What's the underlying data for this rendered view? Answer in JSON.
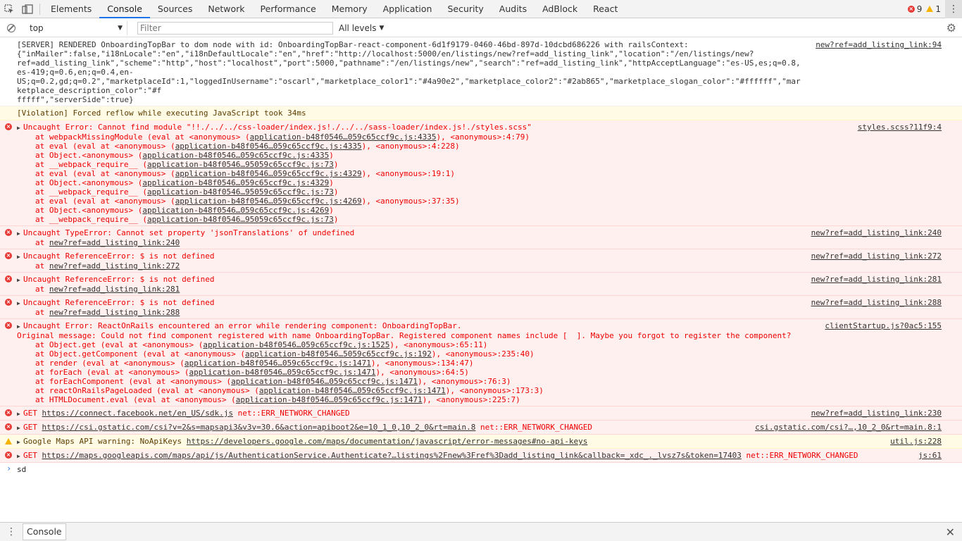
{
  "tabs": [
    {
      "label": "Elements"
    },
    {
      "label": "Console",
      "active": true
    },
    {
      "label": "Sources"
    },
    {
      "label": "Network"
    },
    {
      "label": "Performance"
    },
    {
      "label": "Memory"
    },
    {
      "label": "Application"
    },
    {
      "label": "Security"
    },
    {
      "label": "Audits"
    },
    {
      "label": "AdBlock"
    },
    {
      "label": "React"
    }
  ],
  "counts": {
    "errors": "9",
    "warnings": "1"
  },
  "toolbar": {
    "context": "top",
    "filter_placeholder": "Filter",
    "levels": "All levels"
  },
  "colors": {
    "error_bg": "#fff0f0",
    "error_text": "#ee0000",
    "warn_bg": "#fffbe5",
    "accent": "#1a73e8"
  },
  "messages": {
    "m1": {
      "text": "[SERVER] RENDERED OnboardingTopBar to dom node with id: OnboardingTopBar-react-component-6d1f9179-0460-46bd-897d-10dcbd686226 with railsContext:\n{\"inMailer\":false,\"i18nLocale\":\"en\",\"i18nDefaultLocale\":\"en\",\"href\":\"http://localhost:5000/en/listings/new?ref=add_listing_link\",\"location\":\"/en/listings/new?\nref=add_listing_link\",\"scheme\":\"http\",\"host\":\"localhost\",\"port\":5000,\"pathname\":\"/en/listings/new\",\"search\":\"ref=add_listing_link\",\"httpAcceptLanguage\":\"es-US,es;q=0.8,es-419;q=0.6,en;q=0.4,en-\nUS;q=0.2,gd;q=0.2\",\"marketplaceId\":1,\"loggedInUsername\":\"oscarl\",\"marketplace_color1\":\"#4a90e2\",\"marketplace_color2\":\"#2ab865\",\"marketplace_slogan_color\":\"#ffffff\",\"marketplace_description_color\":\"#f\nfffff\",\"serverSide\":true}",
      "src": "new?ref=add_listing_link:94"
    },
    "m2": {
      "text": "[Violation] Forced reflow while executing JavaScript took 34ms"
    },
    "m3": {
      "text": "Uncaught Error: Cannot find module \"!!./../../css-loader/index.js!./../../sass-loader/index.js!./styles.scss\"",
      "src": "styles.scss?11f9:4",
      "stack": [
        {
          "pre": "at webpackMissingModule (eval at <anonymous> (",
          "link": "application-b48f0546…059c65ccf9c.js:4335",
          "post": "), <anonymous>:4:79)"
        },
        {
          "pre": "at eval (eval at <anonymous> (",
          "link": "application-b48f0546…059c65ccf9c.js:4335",
          "post": "), <anonymous>:4:228)"
        },
        {
          "pre": "at Object.<anonymous> (",
          "link": "application-b48f0546…059c65ccf9c.js:4335",
          "post": ")"
        },
        {
          "pre": "at __webpack_require__ (",
          "link": "application-b48f0546…95059c65ccf9c.js:73",
          "post": ")"
        },
        {
          "pre": "at eval (eval at <anonymous> (",
          "link": "application-b48f0546…059c65ccf9c.js:4329",
          "post": "), <anonymous>:19:1)"
        },
        {
          "pre": "at Object.<anonymous> (",
          "link": "application-b48f0546…059c65ccf9c.js:4329",
          "post": ")"
        },
        {
          "pre": "at __webpack_require__ (",
          "link": "application-b48f0546…95059c65ccf9c.js:73",
          "post": ")"
        },
        {
          "pre": "at eval (eval at <anonymous> (",
          "link": "application-b48f0546…059c65ccf9c.js:4269",
          "post": "), <anonymous>:37:35)"
        },
        {
          "pre": "at Object.<anonymous> (",
          "link": "application-b48f0546…059c65ccf9c.js:4269",
          "post": ")"
        },
        {
          "pre": "at __webpack_require__ (",
          "link": "application-b48f0546…95059c65ccf9c.js:73",
          "post": ")"
        }
      ]
    },
    "m4": {
      "text": "Uncaught TypeError: Cannot set property 'jsonTranslations' of undefined",
      "src": "new?ref=add_listing_link:240",
      "at": "at ",
      "link": "new?ref=add_listing_link:240"
    },
    "m5": {
      "text": "Uncaught ReferenceError: $ is not defined",
      "src": "new?ref=add_listing_link:272",
      "at": "at ",
      "link": "new?ref=add_listing_link:272"
    },
    "m6": {
      "text": "Uncaught ReferenceError: $ is not defined",
      "src": "new?ref=add_listing_link:281",
      "at": "at ",
      "link": "new?ref=add_listing_link:281"
    },
    "m7": {
      "text": "Uncaught ReferenceError: $ is not defined",
      "src": "new?ref=add_listing_link:288",
      "at": "at ",
      "link": "new?ref=add_listing_link:288"
    },
    "m8": {
      "text": "Uncaught Error: ReactOnRails encountered an error while rendering component: OnboardingTopBar.",
      "text2": "Original message: Could not find component registered with name OnboardingTopBar. Registered component names include [  ]. Maybe you forgot to register the component?",
      "src": "clientStartup.js?0ac5:155",
      "stack": [
        {
          "pre": "at Object.get (eval at <anonymous> (",
          "link": "application-b48f0546…059c65ccf9c.js:1525",
          "post": "), <anonymous>:65:11)"
        },
        {
          "pre": "at Object.getComponent (eval at <anonymous> (",
          "link": "application-b48f0546…5059c65ccf9c.js:192",
          "post": "), <anonymous>:235:40)"
        },
        {
          "pre": "at render (eval at <anonymous> (",
          "link": "application-b48f0546…059c65ccf9c.js:1471",
          "post": "), <anonymous>:134:47)"
        },
        {
          "pre": "at forEach (eval at <anonymous> (",
          "link": "application-b48f0546…059c65ccf9c.js:1471",
          "post": "), <anonymous>:64:5)"
        },
        {
          "pre": "at forEachComponent (eval at <anonymous> (",
          "link": "application-b48f0546…059c65ccf9c.js:1471",
          "post": "), <anonymous>:76:3)"
        },
        {
          "pre": "at reactOnRailsPageLoaded (eval at <anonymous> (",
          "link": "application-b48f0546…059c65ccf9c.js:1471",
          "post": "), <anonymous>:173:3)"
        },
        {
          "pre": "at HTMLDocument.eval (eval at <anonymous> (",
          "link": "application-b48f0546…059c65ccf9c.js:1471",
          "post": "), <anonymous>:225:7)"
        }
      ]
    },
    "m9": {
      "pre": "GET ",
      "link": "https://connect.facebook.net/en_US/sdk.js",
      "post": " net::ERR_NETWORK_CHANGED",
      "src": "new?ref=add_listing_link:230"
    },
    "m10": {
      "pre": "GET ",
      "link": "https://csi.gstatic.com/csi?v=2&s=mapsapi3&v3v=30.6&action=apiboot2&e=10_1_0,10_2_0&rt=main.8",
      "post": " net::ERR_NETWORK_CHANGED",
      "src": "csi.gstatic.com/csi?…,10_2_0&rt=main.8:1"
    },
    "m11": {
      "pre": "Google Maps API warning: NoApiKeys ",
      "link": "https://developers.google.com/maps/documentation/javascript/error-messages#no-api-keys",
      "src": "util.js:228"
    },
    "m12": {
      "pre": "GET ",
      "link": "https://maps.googleapis.com/maps/api/js/AuthenticationService.Authenticate?…listings%2Fnew%3Fref%3Dadd_listing_link&callback=_xdc_._lvsz7s&token=17403",
      "post": " net::ERR_NETWORK_CHANGED",
      "src": "js:61"
    }
  },
  "prompt": {
    "input": "sd"
  },
  "drawer": {
    "tab": "Console"
  }
}
